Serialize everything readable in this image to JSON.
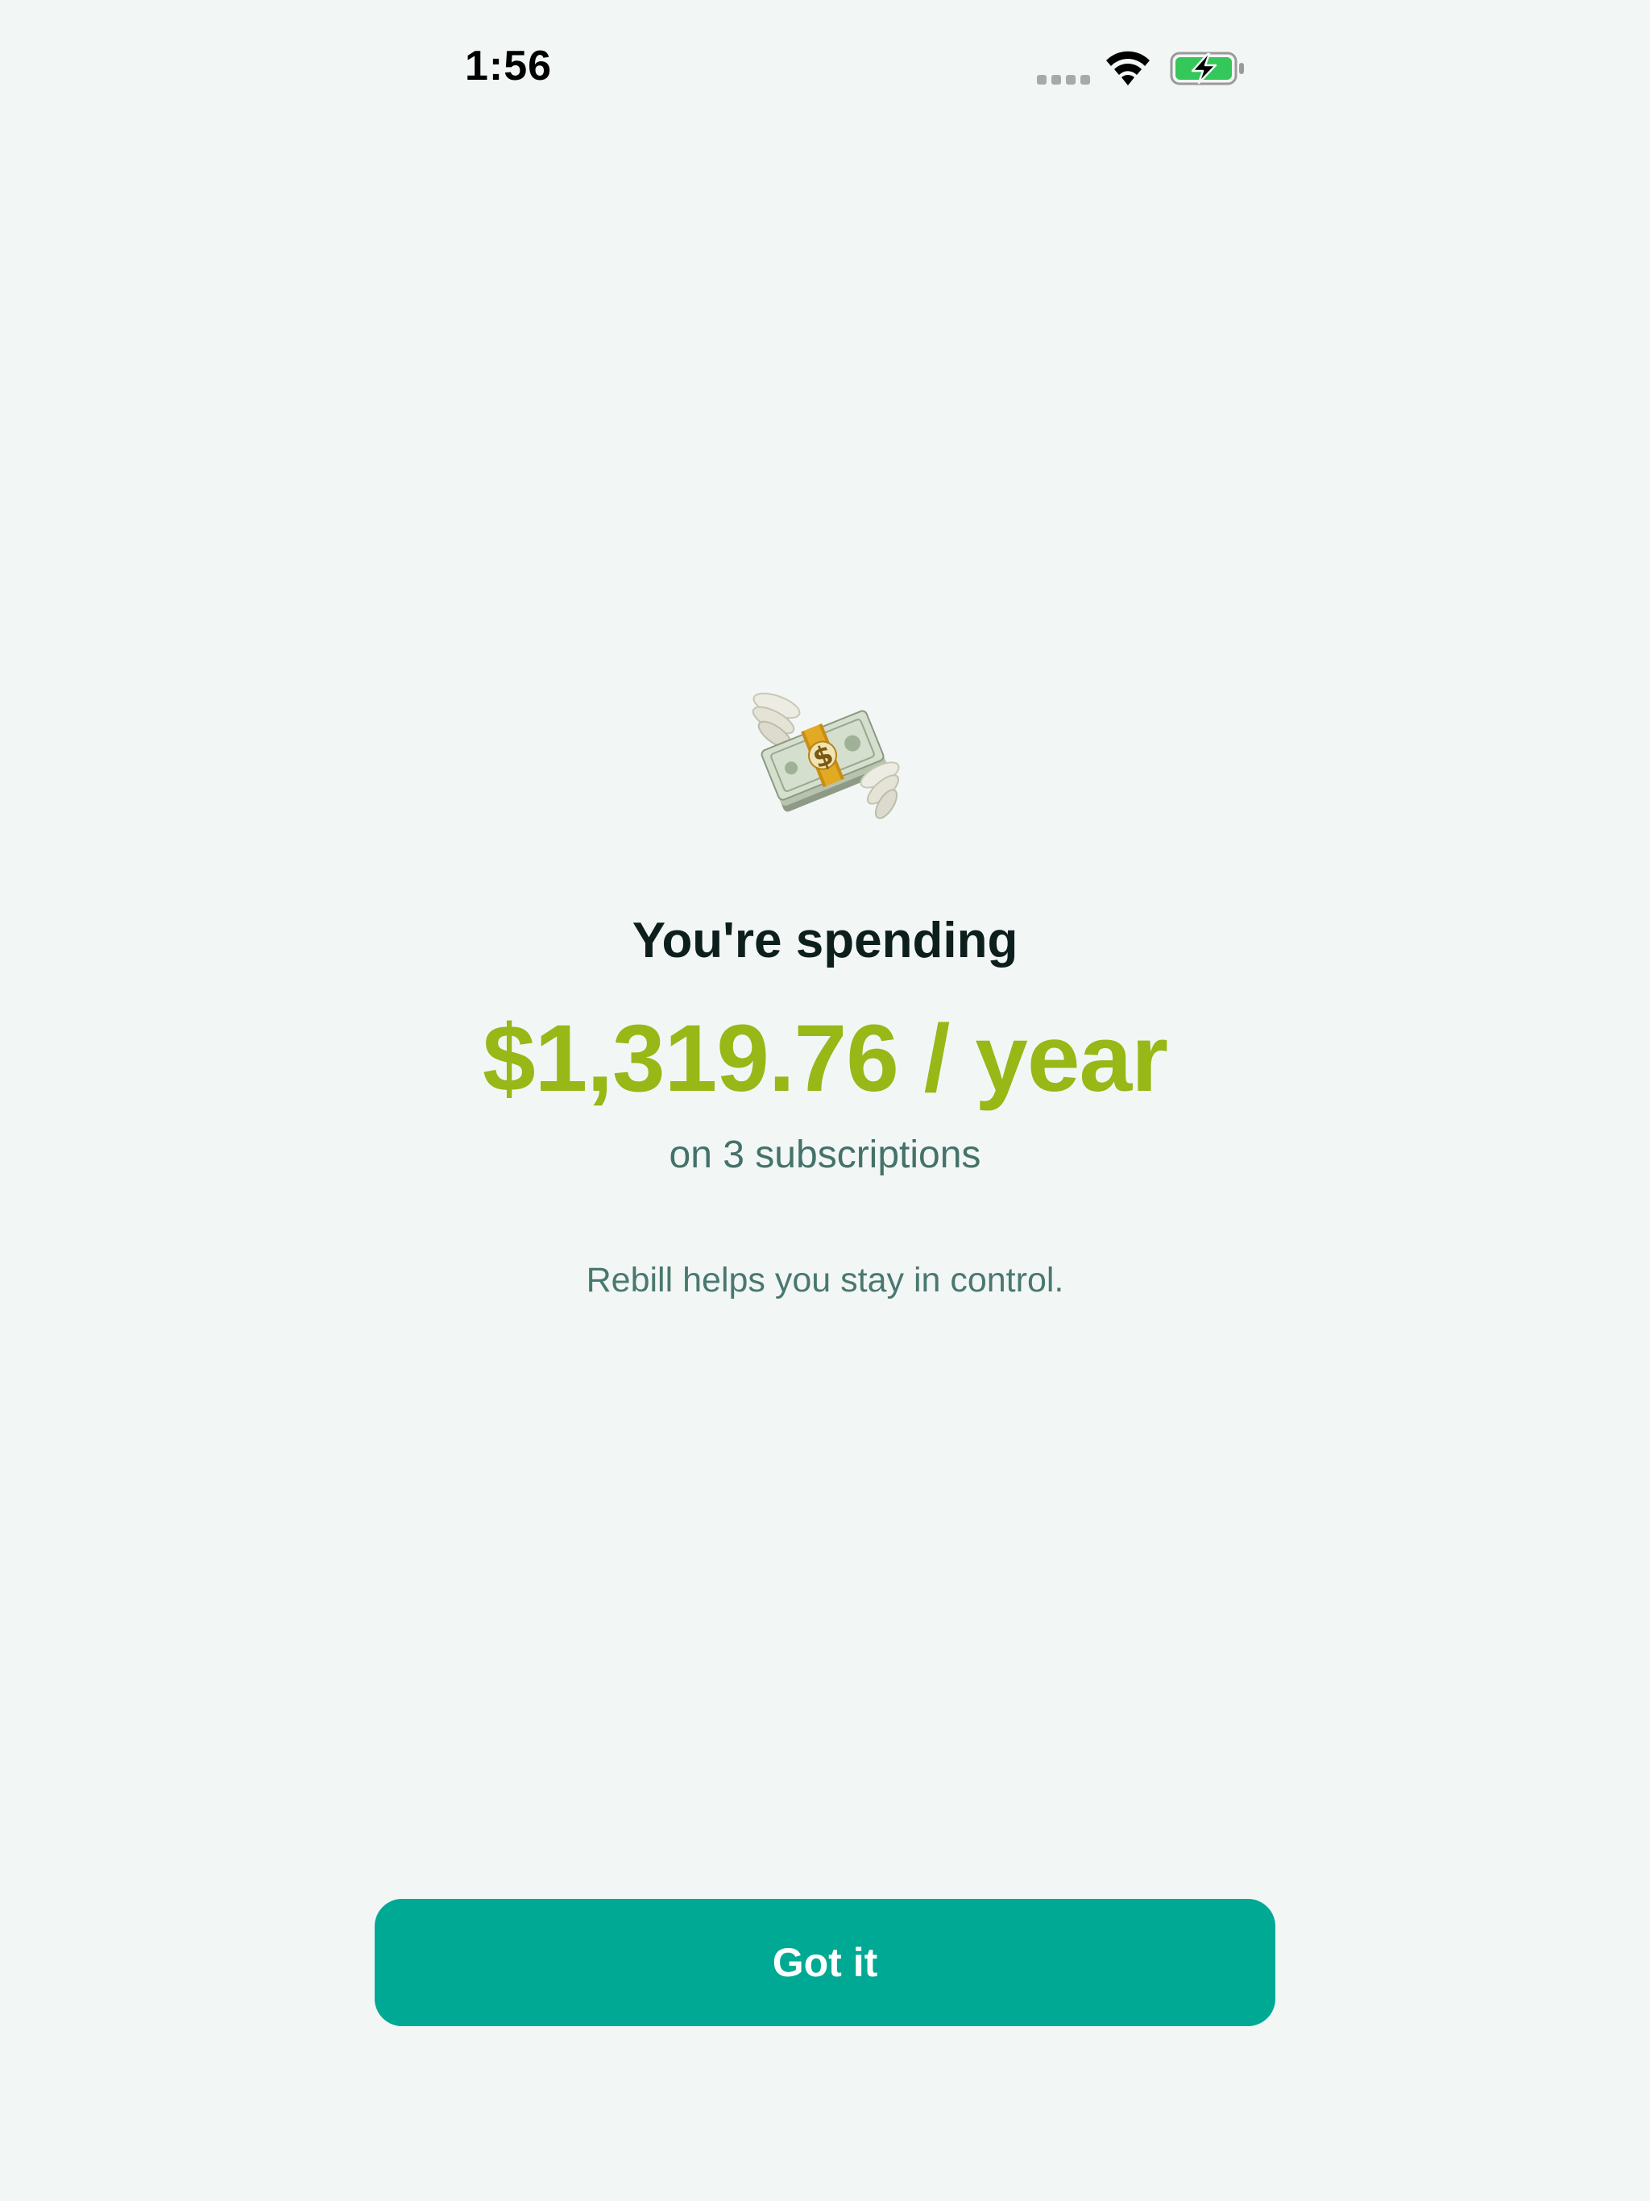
{
  "status_bar": {
    "time": "1:56",
    "icons": [
      "cellular-signal-icon",
      "wifi-icon",
      "battery-charging-icon"
    ],
    "battery_color": "#34c759"
  },
  "hero": {
    "icon": "money-with-wings-icon"
  },
  "summary": {
    "heading": "You're spending",
    "amount": "$1,319.76 / year",
    "subscriptions": "on 3 subscriptions",
    "tagline": "Rebill helps you stay in control."
  },
  "actions": {
    "primary_label": "Got it"
  },
  "colors": {
    "background": "#f2f7f6",
    "amount": "#97b816",
    "button": "#00a993",
    "secondary_text": "#447269"
  }
}
